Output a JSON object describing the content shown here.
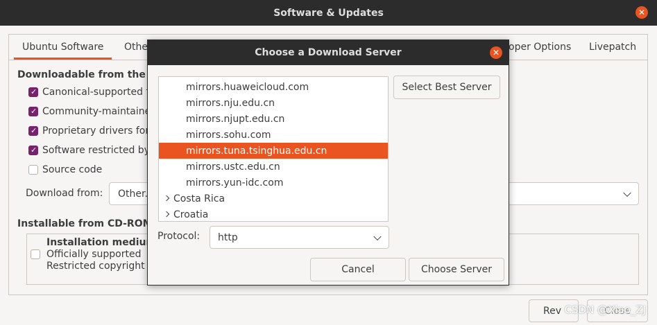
{
  "window": {
    "title": "Software & Updates",
    "close_glyph": "✕"
  },
  "tabs": [
    {
      "label": "Ubuntu Software",
      "active": true
    },
    {
      "label": "Othe"
    },
    {
      "label": "oper Options"
    },
    {
      "label": "Livepatch"
    }
  ],
  "downloadable": {
    "title": "Downloadable from the In",
    "items": [
      {
        "label": "Canonical-supported fr",
        "checked": true
      },
      {
        "label": "Community-maintained",
        "checked": true
      },
      {
        "label": "Proprietary drivers for",
        "checked": true
      },
      {
        "label": "Software restricted by",
        "checked": true
      },
      {
        "label": "Source code",
        "checked": false
      }
    ],
    "download_from_label": "Download from:",
    "download_from_value": "Other."
  },
  "installable": {
    "title": "Installable from CD-ROM/",
    "medium_title": "Installation medium",
    "medium_line1": "Officially supported",
    "medium_line2": "Restricted copyright"
  },
  "footer": {
    "revert_label": "Rev",
    "close_label": "Close"
  },
  "watermark": "CSDN @Xiao_ZJ",
  "dialog": {
    "title": "Choose a Download Server",
    "close_glyph": "✕",
    "servers": [
      {
        "label": "mirrors.huaweicloud.com",
        "selected": false
      },
      {
        "label": "mirrors.nju.edu.cn",
        "selected": false
      },
      {
        "label": "mirrors.njupt.edu.cn",
        "selected": false
      },
      {
        "label": "mirrors.sohu.com",
        "selected": false
      },
      {
        "label": "mirrors.tuna.tsinghua.edu.cn",
        "selected": true
      },
      {
        "label": "mirrors.ustc.edu.cn",
        "selected": false
      },
      {
        "label": "mirrors.yun-idc.com",
        "selected": false
      }
    ],
    "countries": [
      "Costa Rica",
      "Croatia"
    ],
    "select_best_label": "Select Best Server",
    "protocol_label": "Protocol:",
    "protocol_value": "http",
    "cancel_label": "Cancel",
    "choose_label": "Choose Server"
  },
  "colors": {
    "accent": "#e95420",
    "title_bar": "#2c2c2c",
    "checkbox": "#77216f",
    "background": "#f6f5f4"
  }
}
